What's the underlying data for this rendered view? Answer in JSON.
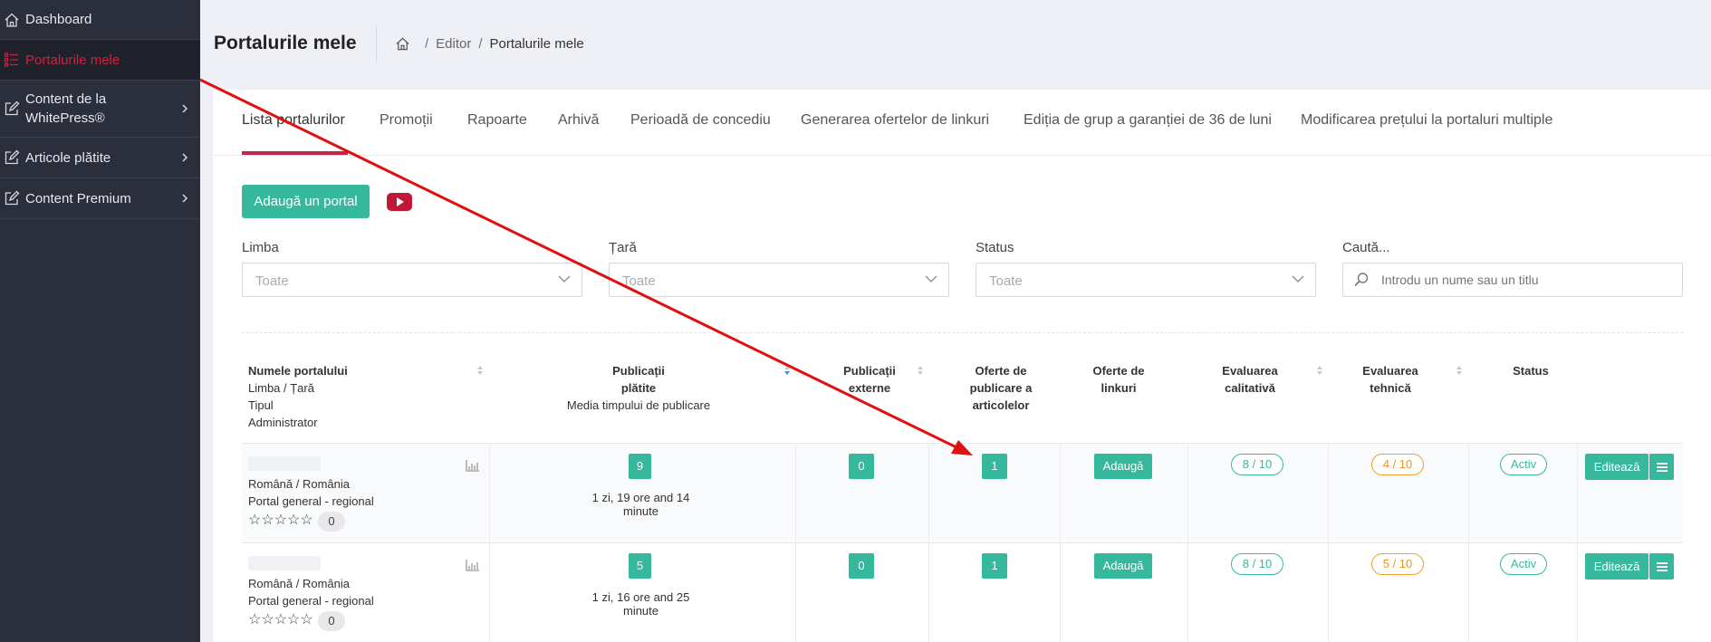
{
  "sidebar": {
    "items": [
      {
        "label": "Dashboard",
        "icon": "home-icon"
      },
      {
        "label": "Portalurile mele",
        "icon": "list-icon",
        "active": true
      },
      {
        "label": "Content de la WhitePress®",
        "line1": "Content de la",
        "line2": "WhitePress®",
        "icon": "edit-icon"
      },
      {
        "label": "Articole plătite",
        "icon": "edit-icon"
      },
      {
        "label": "Content Premium",
        "icon": "edit-icon"
      }
    ]
  },
  "header": {
    "title": "Portalurile mele",
    "breadcrumb": [
      "Editor",
      "Portalurile mele"
    ]
  },
  "tabs": [
    "Lista portalurilor",
    "Promoții",
    "Rapoarte",
    "Arhivă",
    "Perioadă de concediu",
    "Generarea ofertelor de linkuri",
    "Ediția de grup a garanției de 36 de luni",
    "Modificarea prețului la portaluri multiple"
  ],
  "actions": {
    "add_portal": "Adaugă un portal"
  },
  "filters": {
    "language": {
      "label": "Limba",
      "value": "Toate"
    },
    "country": {
      "label": "Țară",
      "value": "Toate"
    },
    "status": {
      "label": "Status",
      "value": "Toate"
    },
    "search": {
      "label": "Caută...",
      "placeholder": "Introdu un nume sau un titlu"
    }
  },
  "table": {
    "headers": {
      "portal": [
        "Numele portalului",
        "Limba / Țară",
        "Tipul",
        "Administrator"
      ],
      "paid": [
        "Publicații",
        "plătite",
        "Media timpului de publicare"
      ],
      "external": [
        "Publicații",
        "externe"
      ],
      "offers_pub": [
        "Oferte de",
        "publicare a",
        "articolelor"
      ],
      "offers_links": [
        "Oferte de",
        "linkuri"
      ],
      "quality": [
        "Evaluarea",
        "calitativă"
      ],
      "technical": [
        "Evaluarea",
        "tehnică"
      ],
      "status": "Status"
    },
    "rows": [
      {
        "lang_country": "Română / România",
        "type": "Portal general - regional",
        "reviews": "0",
        "paid": "9",
        "paid_time": "1 zi, 19 ore and 14 minute",
        "external": "0",
        "offers": "1",
        "add_label": "Adaugă",
        "quality": "8 / 10",
        "technical": "4 / 10",
        "status": "Activ",
        "edit_label": "Editează"
      },
      {
        "lang_country": "Română / România",
        "type": "Portal general - regional",
        "reviews": "0",
        "paid": "5",
        "paid_time": "1 zi, 16 ore and 25 minute",
        "external": "0",
        "offers": "1",
        "add_label": "Adaugă",
        "quality": "8 / 10",
        "technical": "5 / 10",
        "status": "Activ",
        "edit_label": "Editează"
      }
    ]
  },
  "colors": {
    "accent": "#35b89b",
    "brand_red": "#c42548",
    "sidebar_bg": "#2b2e3b",
    "annotation_arrow": "#e01010"
  }
}
